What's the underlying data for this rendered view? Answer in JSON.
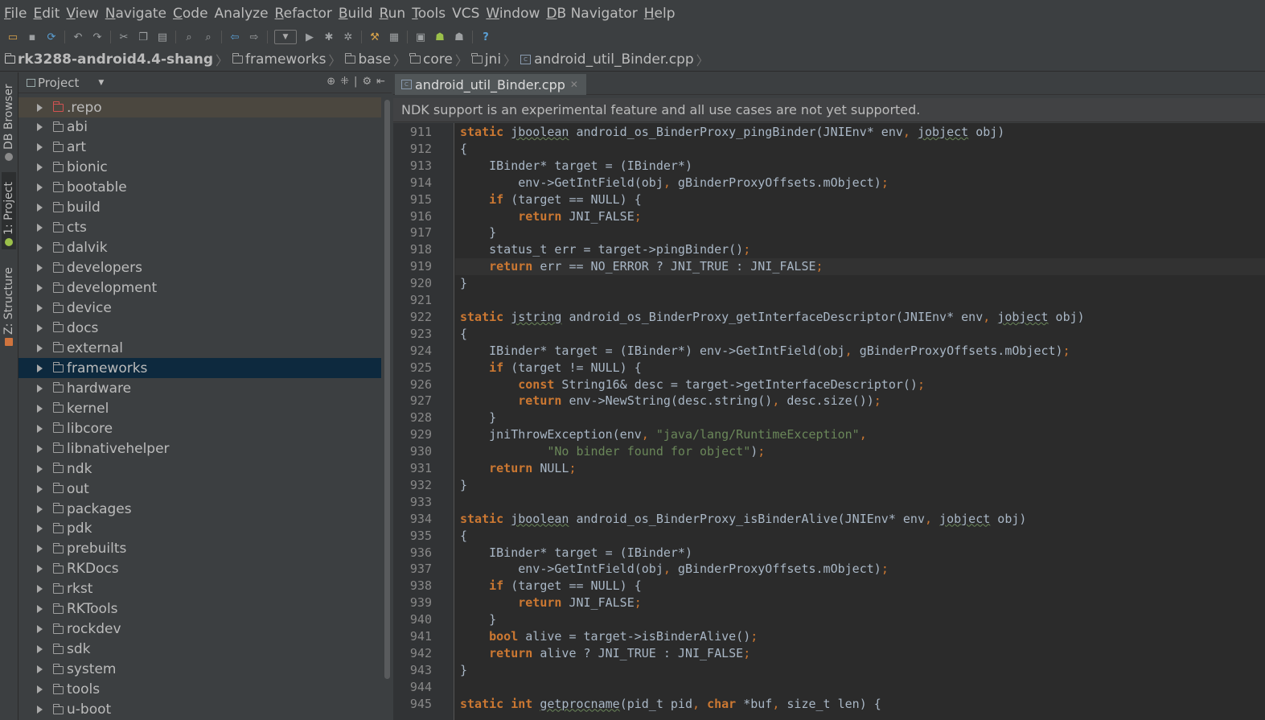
{
  "menu": {
    "items": [
      {
        "mnemonic": "F",
        "rest": "ile"
      },
      {
        "mnemonic": "E",
        "rest": "dit"
      },
      {
        "mnemonic": "V",
        "rest": "iew"
      },
      {
        "mnemonic": "N",
        "rest": "avigate"
      },
      {
        "mnemonic": "C",
        "rest": "ode"
      },
      {
        "mnemonic": "",
        "rest": "Analyze"
      },
      {
        "mnemonic": "R",
        "rest": "efactor"
      },
      {
        "mnemonic": "B",
        "rest": "uild"
      },
      {
        "mnemonic": "R",
        "rest": "un"
      },
      {
        "mnemonic": "T",
        "rest": "ools"
      },
      {
        "mnemonic": "",
        "rest": "VCS"
      },
      {
        "mnemonic": "W",
        "rest": "indow"
      },
      {
        "mnemonic": "D",
        "rest": "B Navigator"
      },
      {
        "mnemonic": "H",
        "rest": "elp"
      }
    ]
  },
  "breadcrumb": [
    "rk3288-android4.4-shang",
    "frameworks",
    "base",
    "core",
    "jni",
    "android_util_Binder.cpp"
  ],
  "side_tabs": [
    "DB Browser",
    "1: Project",
    "Z: Structure"
  ],
  "project": {
    "title": "Project",
    "tree": [
      ".repo",
      "abi",
      "art",
      "bionic",
      "bootable",
      "build",
      "cts",
      "dalvik",
      "developers",
      "development",
      "device",
      "docs",
      "external",
      "frameworks",
      "hardware",
      "kernel",
      "libcore",
      "libnativehelper",
      "ndk",
      "out",
      "packages",
      "pdk",
      "prebuilts",
      "RKDocs",
      "rkst",
      "RKTools",
      "rockdev",
      "sdk",
      "system",
      "tools",
      "u-boot"
    ],
    "selected": "frameworks"
  },
  "editor": {
    "tab_label": "android_util_Binder.cpp",
    "banner": "NDK support is an experimental feature and all use cases are not yet supported.",
    "first_line": 911,
    "caret_line": 919,
    "lines": [
      "static jboolean android_os_BinderProxy_pingBinder(JNIEnv* env, jobject obj)",
      "{",
      "    IBinder* target = (IBinder*)",
      "        env->GetIntField(obj, gBinderProxyOffsets.mObject);",
      "    if (target == NULL) {",
      "        return JNI_FALSE;",
      "    }",
      "    status_t err = target->pingBinder();",
      "    return err == NO_ERROR ? JNI_TRUE : JNI_FALSE;",
      "}",
      "",
      "static jstring android_os_BinderProxy_getInterfaceDescriptor(JNIEnv* env, jobject obj)",
      "{",
      "    IBinder* target = (IBinder*) env->GetIntField(obj, gBinderProxyOffsets.mObject);",
      "    if (target != NULL) {",
      "        const String16& desc = target->getInterfaceDescriptor();",
      "        return env->NewString(desc.string(), desc.size());",
      "    }",
      "    jniThrowException(env, \"java/lang/RuntimeException\",",
      "            \"No binder found for object\");",
      "    return NULL;",
      "}",
      "",
      "static jboolean android_os_BinderProxy_isBinderAlive(JNIEnv* env, jobject obj)",
      "{",
      "    IBinder* target = (IBinder*)",
      "        env->GetIntField(obj, gBinderProxyOffsets.mObject);",
      "    if (target == NULL) {",
      "        return JNI_FALSE;",
      "    }",
      "    bool alive = target->isBinderAlive();",
      "    return alive ? JNI_TRUE : JNI_FALSE;",
      "}",
      "",
      "static int getprocname(pid_t pid, char *buf, size_t len) {"
    ]
  },
  "colors": {
    "background": "#2b2b2b",
    "keyword": "#cc7832",
    "string": "#6a8759",
    "selection": "#0d293e"
  }
}
